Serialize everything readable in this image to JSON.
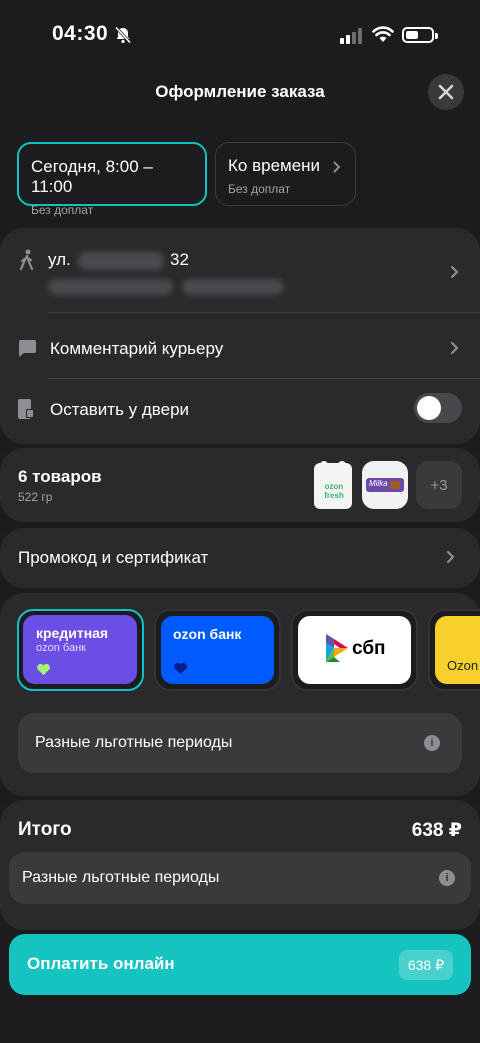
{
  "status": {
    "time": "04:30"
  },
  "header": {
    "title": "Оформление заказа"
  },
  "delivery_times": [
    {
      "title": "Сегодня, 8:00 – 11:00",
      "subtitle": "Без доплат"
    },
    {
      "title": "Ко времени",
      "subtitle": "Без доплат"
    }
  ],
  "address": {
    "street_prefix": "ул.",
    "house": "32"
  },
  "rows": {
    "comment": "Комментарий курьеру",
    "leave_at_door": "Оставить у двери"
  },
  "items": {
    "count_label": "6 товаров",
    "weight": "522 гр",
    "more": "+3",
    "thumb1_text": "ozon fresh",
    "thumb2_text": "Milka"
  },
  "promo": {
    "label": "Промокод и сертификат"
  },
  "payment_methods": [
    {
      "title": "кредитная",
      "subtitle": "ozon банк",
      "color": "#6b4ee6"
    },
    {
      "title": "ozon банк",
      "color": "#005bff"
    },
    {
      "title": "сбп"
    },
    {
      "title": "Ozon",
      "color": "#f8d02b"
    }
  ],
  "grace_info": "Разные льготные периоды",
  "total": {
    "label": "Итого",
    "amount": "638 ₽",
    "grace_info": "Разные льготные периоды"
  },
  "pay_button": {
    "label": "Оплатить онлайн",
    "price": "638 ₽"
  },
  "colors": {
    "accent": "#15c4c0",
    "background": "#1c1c1e",
    "card": "#2a2a2c"
  }
}
